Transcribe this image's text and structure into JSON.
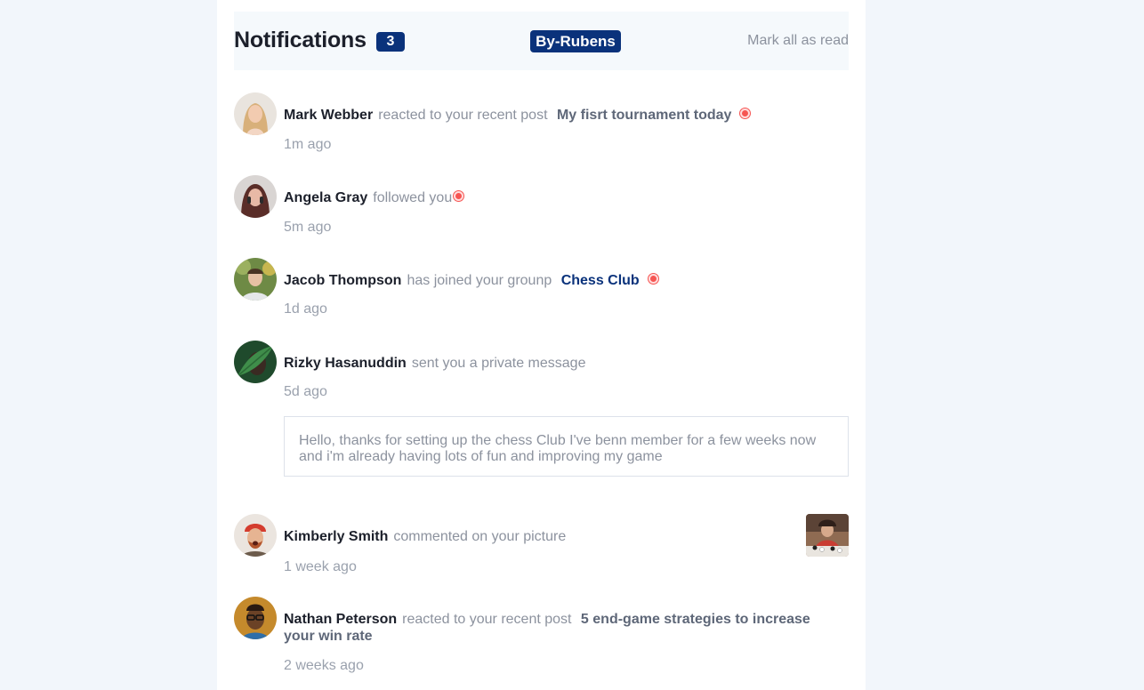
{
  "header": {
    "title": "Notifications",
    "unread_count": "3",
    "author_badge": "By-Rubens",
    "mark_all_label": "Mark all as read"
  },
  "notifications": [
    {
      "name": "Mark Webber",
      "action": "reacted to your recent post",
      "post": "My fisrt tournament today",
      "time": "1m ago",
      "unread": true,
      "avatar_icon": "woman-blonde-avatar"
    },
    {
      "name": "Angela Gray",
      "action": "followed you",
      "time": "5m ago",
      "unread": true,
      "avatar_icon": "woman-red-hair-avatar"
    },
    {
      "name": "Jacob Thompson",
      "action": "has joined your grounp",
      "group": "Chess Club",
      "time": "1d ago",
      "unread": true,
      "avatar_icon": "man-green-background-avatar"
    },
    {
      "name": "Rizky Hasanuddin",
      "action": "sent you a private message",
      "time": "5d ago",
      "message": "Hello, thanks for setting up the chess Club I've benn member for a few weeks now and i'm already having lots of fun and improving my game",
      "unread": false,
      "avatar_icon": "person-leaf-avatar"
    },
    {
      "name": "Kimberly Smith",
      "action": "commented on your picture",
      "time": "1 week ago",
      "unread": false,
      "avatar_icon": "man-red-hat-avatar",
      "thumbnail_icon": "chess-photo-thumbnail"
    },
    {
      "name": "Nathan Peterson",
      "action": "reacted to your recent post",
      "post": "5 end-game strategies to increase your win rate",
      "time": "2 weeks ago",
      "unread": false,
      "avatar_icon": "man-glasses-avatar"
    }
  ],
  "colors": {
    "page_background": "#f2f6fb",
    "card_background": "#ffffff",
    "header_background": "#f5f9fc",
    "badge_blue": "#0a327b",
    "unread_dot": "#f65552",
    "dark_text": "#1c202b",
    "muted_text": "#8c929e"
  }
}
